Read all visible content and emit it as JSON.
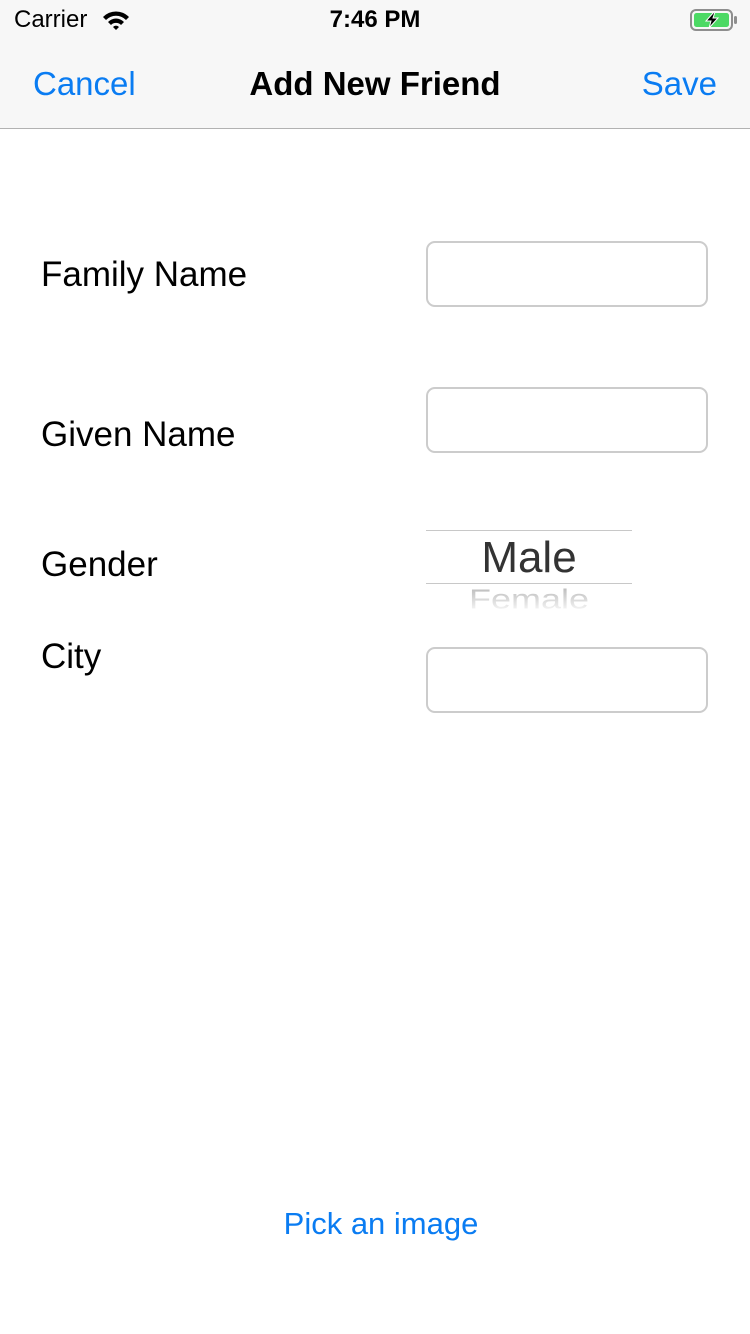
{
  "status_bar": {
    "carrier": "Carrier",
    "time": "7:46 PM",
    "wifi_icon": "wifi-icon",
    "battery_icon": "battery-charging-icon",
    "battery_color": "#4cd964"
  },
  "nav_bar": {
    "cancel_label": "Cancel",
    "title": "Add New Friend",
    "save_label": "Save",
    "tint_color": "#0a7cf2"
  },
  "form": {
    "family_name": {
      "label": "Family Name",
      "value": ""
    },
    "given_name": {
      "label": "Given Name",
      "value": ""
    },
    "gender": {
      "label": "Gender",
      "selected": "Male",
      "next_option": "Female"
    },
    "city": {
      "label": "City",
      "value": ""
    }
  },
  "pick_image_label": "Pick an image"
}
